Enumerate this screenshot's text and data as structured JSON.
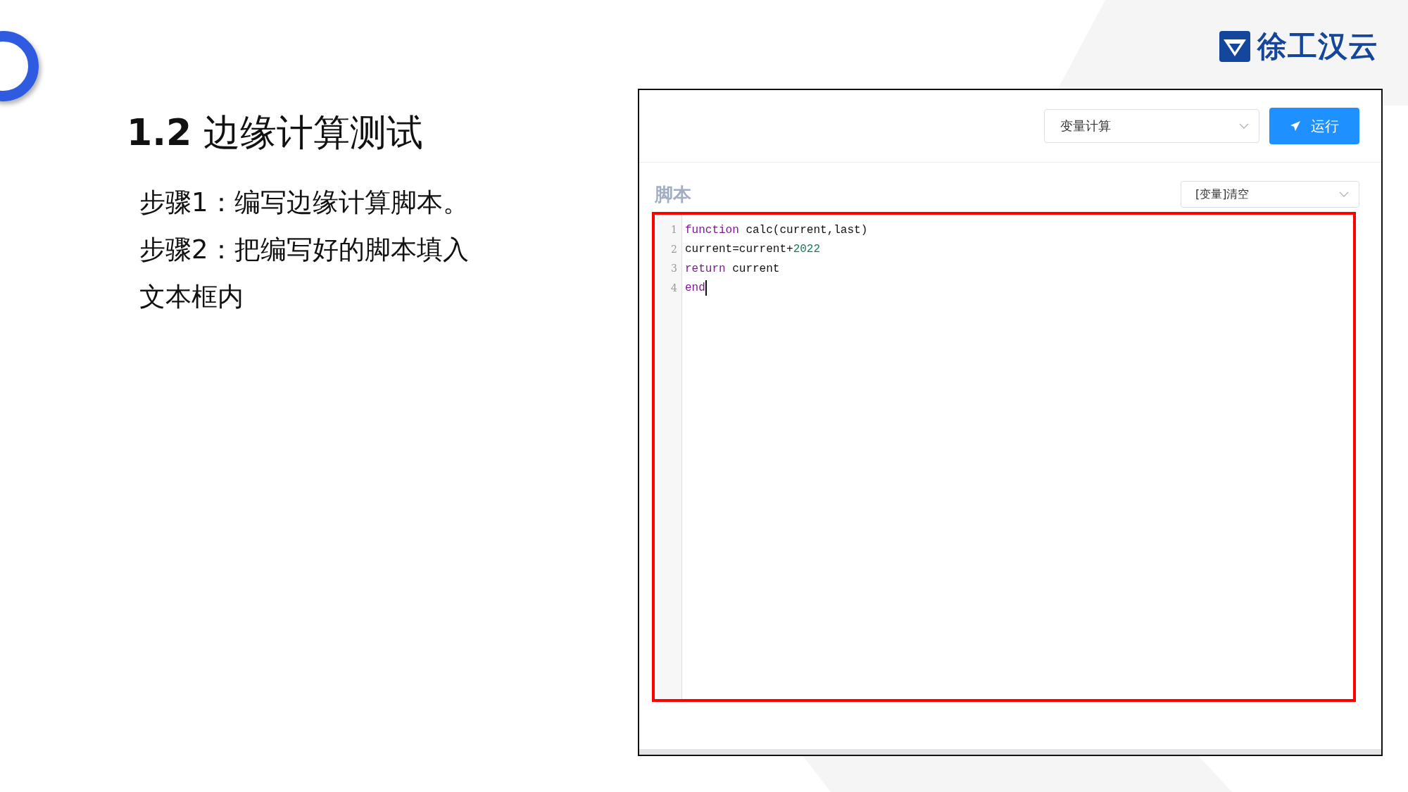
{
  "logo": {
    "text": "徐工汉云"
  },
  "slide": {
    "title": "**1.2** 边缘计算测试",
    "steps": [
      "步骤1：编写边缘计算脚本。",
      "步骤2：把编写好的脚本填入",
      "文本框内"
    ]
  },
  "app": {
    "mode_select": {
      "value": "变量计算"
    },
    "run_button": {
      "label": "运行"
    },
    "section_title": "脚本",
    "template_select": {
      "value": "[变量]清空"
    },
    "editor": {
      "highlighted": true,
      "lines": [
        {
          "number": "1",
          "tokens": [
            {
              "kind": "keyword",
              "text": "function"
            },
            {
              "kind": "plain",
              "text": " calc(current,last)"
            }
          ]
        },
        {
          "number": "2",
          "tokens": [
            {
              "kind": "plain",
              "text": "current=current+"
            },
            {
              "kind": "number",
              "text": "2022"
            }
          ]
        },
        {
          "number": "3",
          "tokens": [
            {
              "kind": "keyword",
              "text": "return"
            },
            {
              "kind": "plain",
              "text": " current"
            }
          ]
        },
        {
          "number": "4",
          "tokens": [
            {
              "kind": "keyword",
              "text": "end"
            }
          ],
          "cursor": true
        }
      ]
    }
  }
}
